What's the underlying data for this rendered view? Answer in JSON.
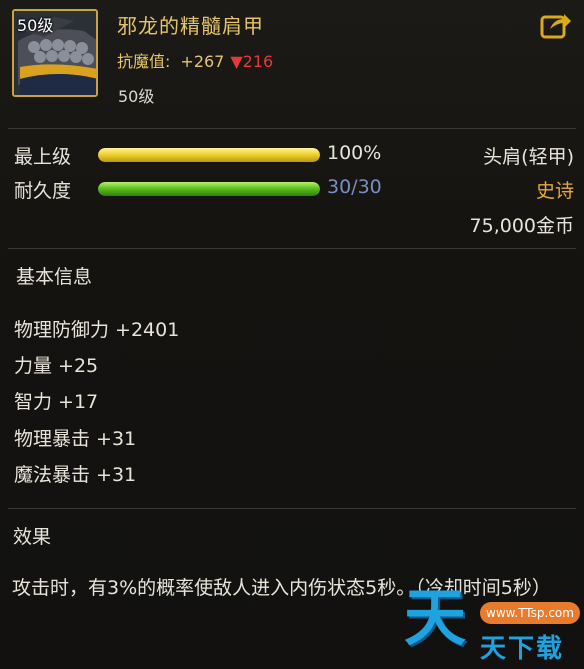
{
  "item": {
    "icon_level": "50级",
    "name": "邪龙的精髓肩甲",
    "resist_label": "抗魔值:",
    "resist_plus": "+267",
    "resist_down": "▼216",
    "req_level": "50级"
  },
  "stats": {
    "max_label": "最上级",
    "max_value": "100%",
    "max_fraction": 1.0,
    "dur_label": "耐久度",
    "dur_value": "30/30",
    "dur_fraction": 1.0,
    "slot": "头肩(轻甲)",
    "rarity": "史诗",
    "price": "75,000金币"
  },
  "basic": {
    "title": "基本信息",
    "attributes": [
      "物理防御力 +2401",
      "力量 +25",
      "智力 +17",
      "物理暴击 +31",
      "魔法暴击 +31"
    ]
  },
  "effect": {
    "title": "效果",
    "text": "攻击时，有3%的概率使敌人进入内伤状态5秒。（冷却时间5秒）"
  },
  "watermark": {
    "big": "天",
    "url": "www.TTsp.com",
    "text": "天下载"
  },
  "colors": {
    "gold_text": "#e5c46a",
    "rarity_epic": "#e6a93a",
    "down_red": "#e4383a",
    "bar_gold": "#f2d22e",
    "bar_green": "#5ec21e",
    "durability_text": "#7a8ec4"
  },
  "icons": [
    "shoulder-armor-icon",
    "share-icon",
    "down-triangle-icon"
  ]
}
